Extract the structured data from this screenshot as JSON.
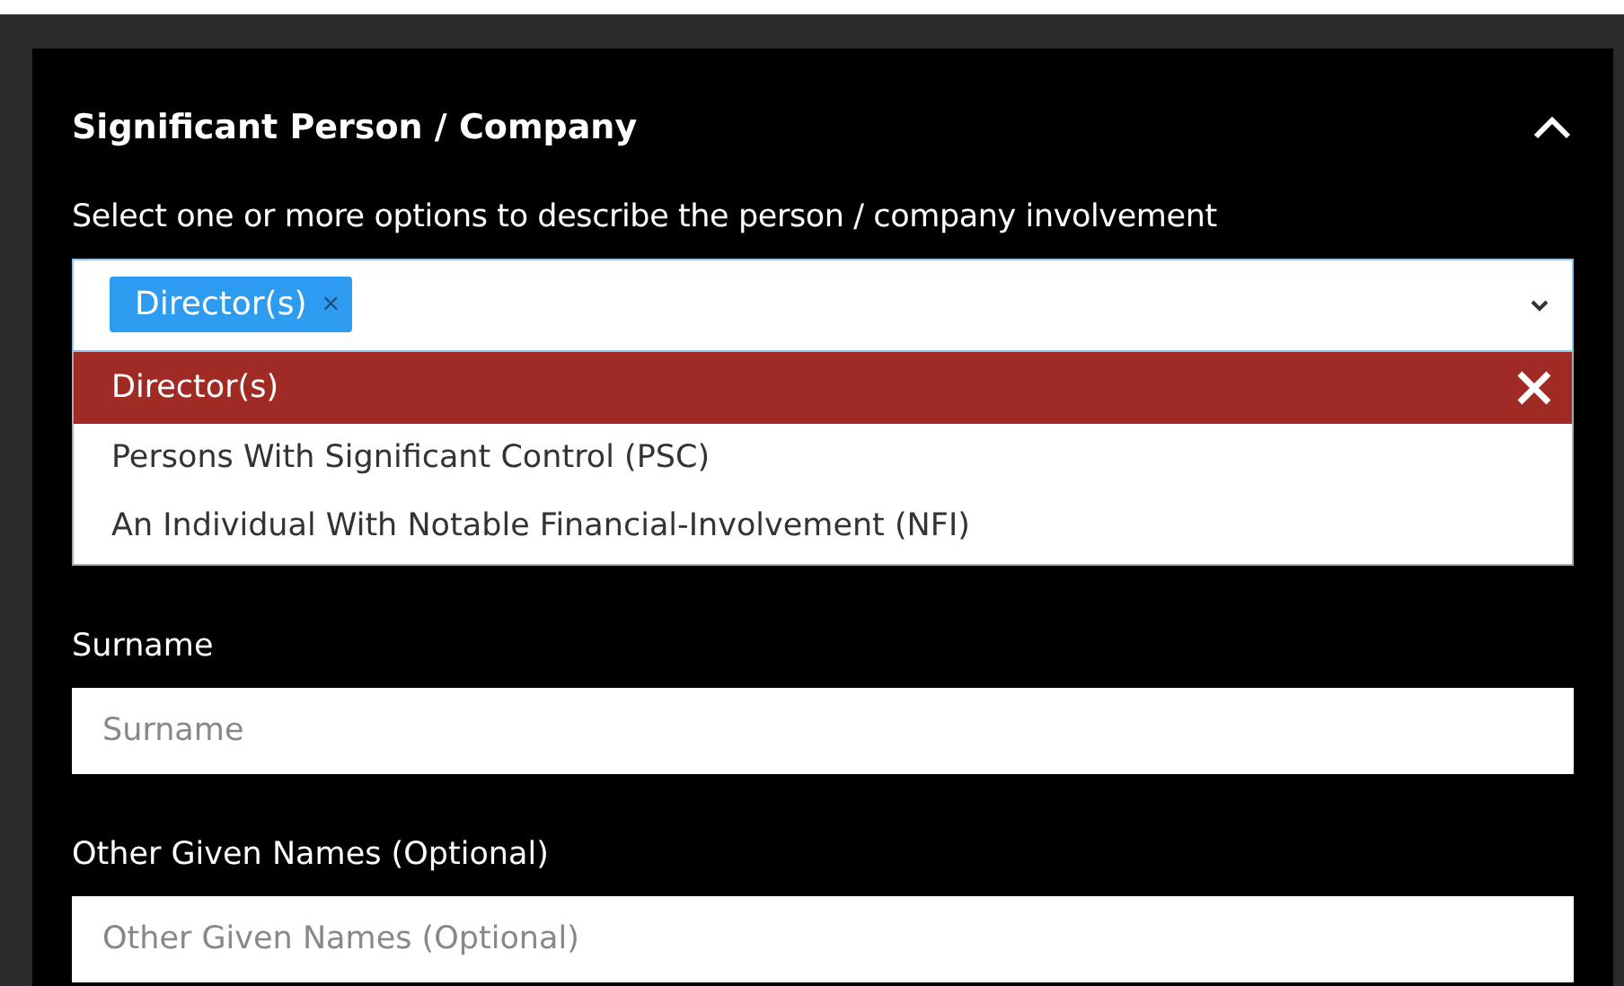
{
  "panel": {
    "title": "Significant Person / Company",
    "expanded": true
  },
  "involvement": {
    "label": "Select one or more options to describe the person / company involvement",
    "chips": [
      {
        "label": "Director(s)",
        "remove": "×"
      }
    ],
    "options": [
      {
        "label": "Director(s)",
        "selected": true
      },
      {
        "label": "Persons With Significant Control (PSC)",
        "selected": false
      },
      {
        "label": "An Individual With Notable Financial-Involvement (NFI)",
        "selected": false
      }
    ]
  },
  "fields": [
    {
      "label": "Surname",
      "placeholder": "Surname"
    },
    {
      "label": "Other Given Names (Optional)",
      "placeholder": "Other Given Names (Optional)"
    }
  ]
}
